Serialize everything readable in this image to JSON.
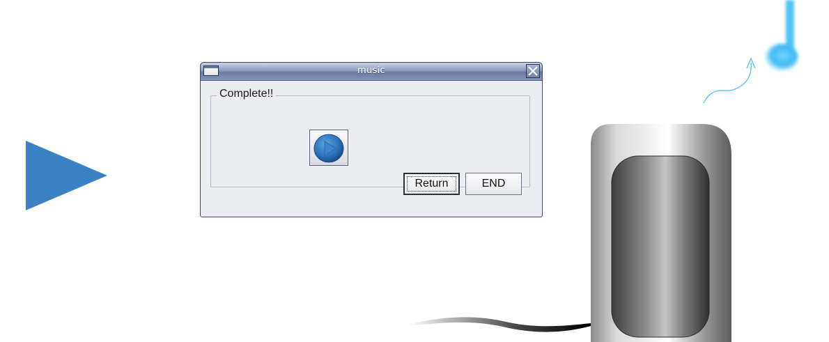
{
  "window": {
    "title": "music"
  },
  "group": {
    "label": "Complete!!"
  },
  "buttons": {
    "return_label": "Return",
    "end_label": "END"
  },
  "icons": {
    "window": "window-icon",
    "close": "close-icon",
    "play": "play-icon",
    "arrow": "play-arrow-icon",
    "speaker": "speaker-icon",
    "note": "music-note-icon"
  },
  "colors": {
    "accent_blue": "#3b82c4",
    "titlebar": "#7a87ab",
    "window_bg": "#ecedf1",
    "note_cyan": "#4fc3f7"
  }
}
